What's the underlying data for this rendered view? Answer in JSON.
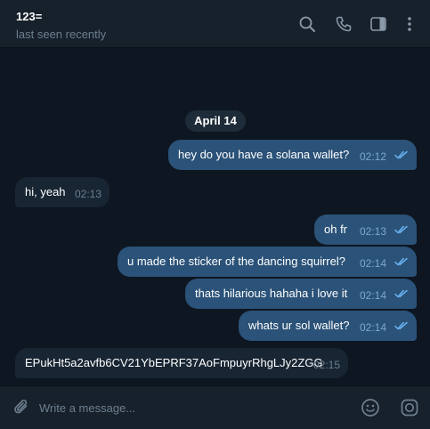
{
  "header": {
    "title": "123=",
    "status": "last seen recently",
    "icons": [
      "search-icon",
      "phone-icon",
      "sidebar-toggle-icon",
      "more-vertical-icon"
    ]
  },
  "date_separator": "April 14",
  "messages": [
    {
      "direction": "out",
      "text": "hey do you have a solana wallet?",
      "time": "02:12",
      "read": true
    },
    {
      "direction": "in",
      "text": "hi, yeah",
      "time": "02:13"
    },
    {
      "direction": "out",
      "text": "oh fr",
      "time": "02:13",
      "read": true
    },
    {
      "direction": "out",
      "text": "u made the sticker of the dancing squirrel?",
      "time": "02:14",
      "read": true
    },
    {
      "direction": "out",
      "text": "thats hilarious hahaha i love it",
      "time": "02:14",
      "read": true
    },
    {
      "direction": "out",
      "text": "whats ur sol wallet?",
      "time": "02:14",
      "read": true
    },
    {
      "direction": "in",
      "text": "EPukHt5a2avfb6CV21YbEPRF37AoFmpuyrRhgLJy2ZGG",
      "time": "02:15"
    }
  ],
  "composer": {
    "placeholder": "Write a message...",
    "value": "",
    "icons": [
      "attach-icon",
      "emoji-icon",
      "sticker-icon"
    ]
  },
  "colors": {
    "background": "#0e1621",
    "header": "#17212b",
    "outgoing_bubble": "#2b5278",
    "incoming_bubble": "#182533",
    "accent": "#6ab2f2"
  }
}
